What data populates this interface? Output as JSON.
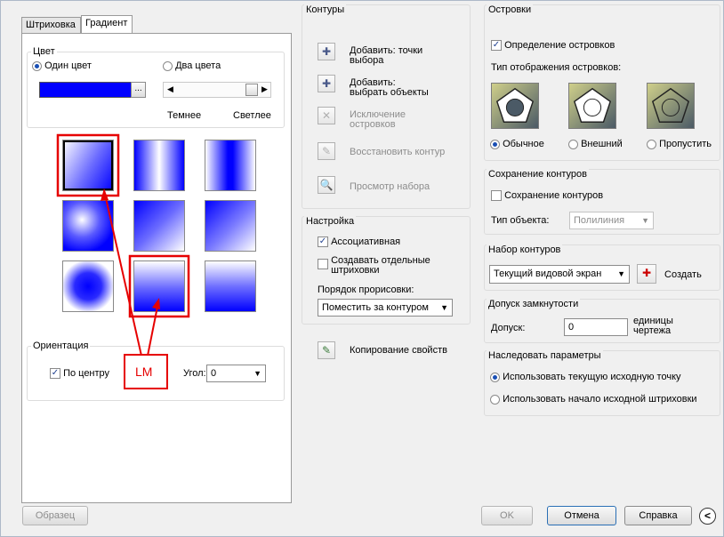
{
  "tabs": [
    "Штриховка",
    "Градиент"
  ],
  "color": {
    "group_label": "Цвет",
    "one_color": "Один цвет",
    "two_colors": "Два цвета",
    "darker": "Темнее",
    "lighter": "Светлее",
    "browse": "...",
    "swatch_color": "#0000ff"
  },
  "orientation": {
    "group_label": "Ориентация",
    "centered": "По центру",
    "angle_label": "Угол:",
    "angle_value": "0"
  },
  "annotation": {
    "label": "LM"
  },
  "contours": {
    "title": "Контуры",
    "items": [
      "Добавить: точки выбора",
      "Добавить: выбрать объекты",
      "Исключение островков",
      "Восстановить контур",
      "Просмотр набора"
    ]
  },
  "settings": {
    "title": "Настройка",
    "associative": "Ассоциативная",
    "separate": "Создавать отдельные штриховки",
    "draw_order_label": "Порядок прорисовки:",
    "draw_order_value": "Поместить за контуром"
  },
  "copy_props": "Копирование свойств",
  "islands": {
    "title": "Островки",
    "detect": "Определение островков",
    "display_type": "Тип отображения островков:",
    "options": [
      "Обычное",
      "Внешний",
      "Пропустить"
    ]
  },
  "retain": {
    "title": "Сохранение контуров",
    "checkbox": "Сохранение контуров",
    "object_type_label": "Тип объекта:",
    "object_type_value": "Полилиния"
  },
  "boundary_set": {
    "title": "Набор контуров",
    "value": "Текущий видовой экран",
    "create": "Создать"
  },
  "gap": {
    "title": "Допуск замкнутости",
    "label": "Допуск:",
    "value": "0",
    "units": "единицы чертежа"
  },
  "inherit": {
    "title": "Наследовать параметры",
    "options": [
      "Использовать текущую исходную точку",
      "Использовать начало исходной штриховки"
    ]
  },
  "buttons": {
    "preview": "Образец",
    "ok": "OK",
    "cancel": "Отмена",
    "help": "Справка"
  }
}
